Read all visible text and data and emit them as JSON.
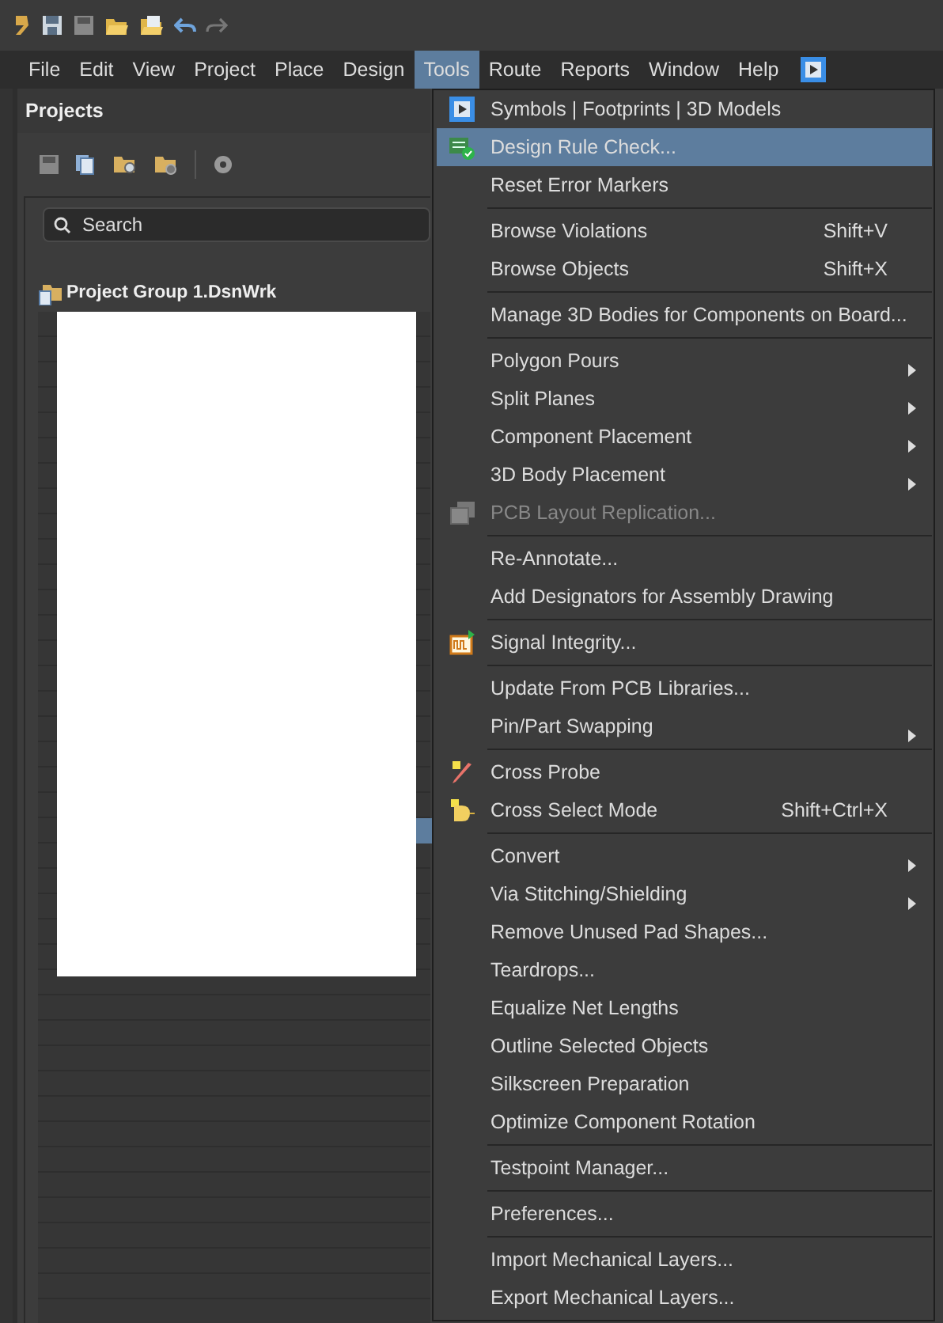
{
  "menubar": [
    {
      "label": "File",
      "selected": false
    },
    {
      "label": "Edit",
      "selected": false
    },
    {
      "label": "View",
      "selected": false
    },
    {
      "label": "Project",
      "selected": false
    },
    {
      "label": "Place",
      "selected": false
    },
    {
      "label": "Design",
      "selected": false
    },
    {
      "label": "Tools",
      "selected": true
    },
    {
      "label": "Route",
      "selected": false
    },
    {
      "label": "Reports",
      "selected": false
    },
    {
      "label": "Window",
      "selected": false
    },
    {
      "label": "Help",
      "selected": false
    }
  ],
  "projects_panel": {
    "title": "Projects",
    "search": {
      "placeholder": "Search"
    },
    "tree": [
      {
        "label": "Project Group 1.DsnWrk"
      }
    ]
  },
  "tools_menu": [
    {
      "kind": "item",
      "label": "Symbols | Footprints | 3D Models",
      "selected": false,
      "disabled": false,
      "submenu": false
    },
    {
      "kind": "item",
      "label": "Design Rule Check...",
      "selected": true,
      "disabled": false,
      "submenu": false
    },
    {
      "kind": "item",
      "label": "Reset Error Markers",
      "selected": false,
      "disabled": false,
      "submenu": false
    },
    {
      "kind": "separator"
    },
    {
      "kind": "item",
      "label": "Browse Violations",
      "shortcut": "Shift+V",
      "selected": false,
      "disabled": false,
      "submenu": false
    },
    {
      "kind": "item",
      "label": "Browse Objects",
      "shortcut": "Shift+X",
      "selected": false,
      "disabled": false,
      "submenu": false
    },
    {
      "kind": "separator"
    },
    {
      "kind": "item",
      "label": "Manage 3D Bodies for Components on Board...",
      "selected": false,
      "disabled": false,
      "submenu": false
    },
    {
      "kind": "separator"
    },
    {
      "kind": "item",
      "label": "Polygon Pours",
      "selected": false,
      "disabled": false,
      "submenu": true
    },
    {
      "kind": "item",
      "label": "Split Planes",
      "selected": false,
      "disabled": false,
      "submenu": true
    },
    {
      "kind": "item",
      "label": "Component Placement",
      "selected": false,
      "disabled": false,
      "submenu": true
    },
    {
      "kind": "item",
      "label": "3D Body Placement",
      "selected": false,
      "disabled": false,
      "submenu": true
    },
    {
      "kind": "item",
      "label": "PCB Layout Replication...",
      "selected": false,
      "disabled": true,
      "submenu": false
    },
    {
      "kind": "separator"
    },
    {
      "kind": "item",
      "label": "Re-Annotate...",
      "selected": false,
      "disabled": false,
      "submenu": false
    },
    {
      "kind": "item",
      "label": "Add Designators for Assembly Drawing",
      "selected": false,
      "disabled": false,
      "submenu": false
    },
    {
      "kind": "separator"
    },
    {
      "kind": "item",
      "label": "Signal Integrity...",
      "selected": false,
      "disabled": false,
      "submenu": false
    },
    {
      "kind": "separator"
    },
    {
      "kind": "item",
      "label": "Update From PCB Libraries...",
      "selected": false,
      "disabled": false,
      "submenu": false
    },
    {
      "kind": "item",
      "label": "Pin/Part Swapping",
      "selected": false,
      "disabled": false,
      "submenu": true
    },
    {
      "kind": "separator"
    },
    {
      "kind": "item",
      "label": "Cross Probe",
      "selected": false,
      "disabled": false,
      "submenu": false
    },
    {
      "kind": "item",
      "label": "Cross Select Mode",
      "shortcut": "Shift+Ctrl+X",
      "selected": false,
      "disabled": false,
      "submenu": false
    },
    {
      "kind": "separator"
    },
    {
      "kind": "item",
      "label": "Convert",
      "selected": false,
      "disabled": false,
      "submenu": true
    },
    {
      "kind": "item",
      "label": "Via Stitching/Shielding",
      "selected": false,
      "disabled": false,
      "submenu": true
    },
    {
      "kind": "item",
      "label": "Remove Unused Pad Shapes...",
      "selected": false,
      "disabled": false,
      "submenu": false
    },
    {
      "kind": "item",
      "label": "Teardrops...",
      "selected": false,
      "disabled": false,
      "submenu": false
    },
    {
      "kind": "item",
      "label": "Equalize Net Lengths",
      "selected": false,
      "disabled": false,
      "submenu": false
    },
    {
      "kind": "item",
      "label": "Outline Selected Objects",
      "selected": false,
      "disabled": false,
      "submenu": false
    },
    {
      "kind": "item",
      "label": "Silkscreen Preparation",
      "selected": false,
      "disabled": false,
      "submenu": false
    },
    {
      "kind": "item",
      "label": "Optimize Component Rotation",
      "selected": false,
      "disabled": false,
      "submenu": false
    },
    {
      "kind": "separator"
    },
    {
      "kind": "item",
      "label": "Testpoint Manager...",
      "selected": false,
      "disabled": false,
      "submenu": false
    },
    {
      "kind": "separator"
    },
    {
      "kind": "item",
      "label": "Preferences...",
      "selected": false,
      "disabled": false,
      "submenu": false
    },
    {
      "kind": "separator"
    },
    {
      "kind": "item",
      "label": "Import Mechanical Layers...",
      "selected": false,
      "disabled": false,
      "submenu": false
    },
    {
      "kind": "item",
      "label": "Export Mechanical Layers...",
      "selected": false,
      "disabled": false,
      "submenu": false
    }
  ]
}
